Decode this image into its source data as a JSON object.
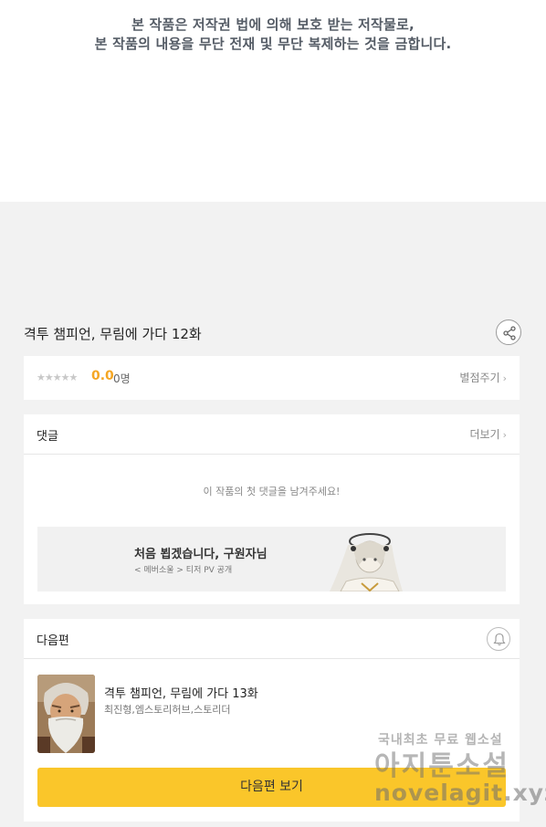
{
  "notice": {
    "line1": "본 작품은 저작권 법에 의해 보호 받는 저작물로,",
    "line2": "본 작품의 내용을 무단 전재 및 무단 복제하는 것을 금합니다."
  },
  "episode": {
    "title": "격투 챔피언, 무림에 가다 12화"
  },
  "rating": {
    "stars": "★★★★★",
    "score": "0.0",
    "count": "0명",
    "rate_label": "별점주기",
    "star_level": 0
  },
  "comments": {
    "title": "댓글",
    "more_label": "더보기",
    "empty_message": "이 작품의 첫 댓글을 남겨주세요!",
    "banner": {
      "title": "처음 뵙겠습니다, 구원자님",
      "subtitle": "< 메버소울 > 티저 PV 공개"
    }
  },
  "next_episode": {
    "section_title": "다음편",
    "title": "격투 챔피언, 무림에 가다 13화",
    "authors": "최진형,엠스토리허브,스토리더",
    "button_label": "다음편 보기"
  },
  "watermark": {
    "line1": "국내최초 무료 웹소설",
    "line2": "아지툰소설",
    "line3": "novelagit.xyz"
  },
  "colors": {
    "accent_yellow": "#fac62a",
    "score_orange": "#f5a623",
    "background": "#f2f2f2"
  },
  "icons": {
    "share": "share-icon",
    "chevron": "chevron-right-icon",
    "bell": "bell-icon"
  }
}
